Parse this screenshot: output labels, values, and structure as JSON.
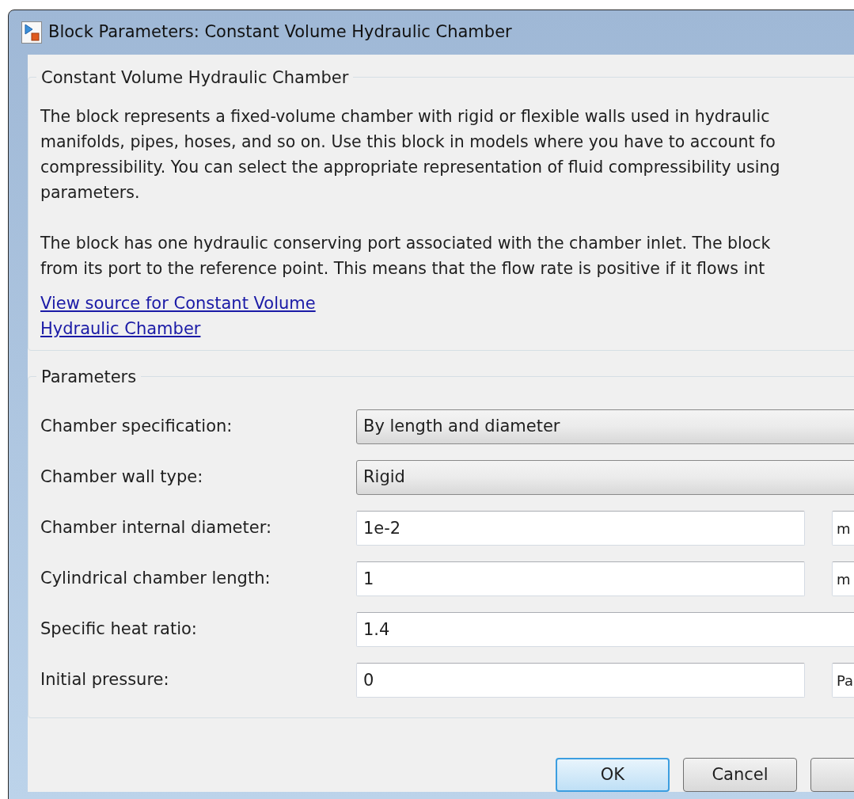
{
  "window": {
    "title": "Block Parameters: Constant Volume Hydraulic Chamber"
  },
  "description": {
    "heading": "Constant Volume Hydraulic Chamber",
    "paragraphs": [
      "The block represents a fixed-volume chamber with rigid or flexible walls used in hydraulic\nmanifolds, pipes, hoses, and so on. Use this block in models where you have to account fo\ncompressibility. You can select the appropriate representation of fluid compressibility using\nparameters.",
      "The block has one hydraulic conserving port associated with the chamber inlet. The block\nfrom its port to the reference point. This means that the flow rate is positive if it flows int"
    ],
    "link": "View source for Constant Volume\nHydraulic Chamber"
  },
  "parameters": {
    "heading": "Parameters",
    "rows": [
      {
        "kind": "dropdown",
        "label": "Chamber specification:",
        "value": "By length and diameter"
      },
      {
        "kind": "dropdown",
        "label": "Chamber wall type:",
        "value": "Rigid"
      },
      {
        "kind": "text",
        "label": "Chamber internal diameter:",
        "value": "1e-2",
        "unit": "m"
      },
      {
        "kind": "text",
        "label": "Cylindrical chamber length:",
        "value": "1",
        "unit": "m"
      },
      {
        "kind": "text",
        "label": "Specific heat ratio:",
        "value": "1.4"
      },
      {
        "kind": "text",
        "label": "Initial pressure:",
        "value": "0",
        "unit": "Pa"
      }
    ]
  },
  "buttons": [
    {
      "label": "OK",
      "selected": true
    },
    {
      "label": "Cancel",
      "selected": false
    },
    {
      "selected": false
    }
  ]
}
